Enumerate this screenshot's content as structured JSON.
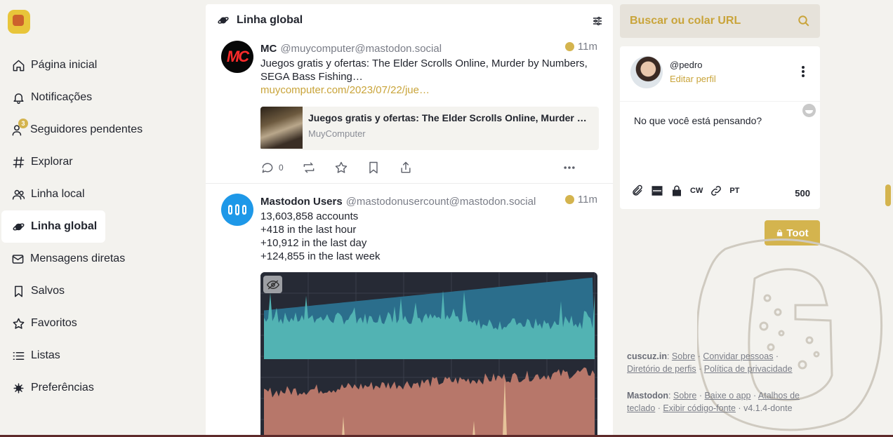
{
  "nav": {
    "items": [
      {
        "label": "Página inicial"
      },
      {
        "label": "Notificações"
      },
      {
        "label": "Seguidores pendentes",
        "badge": "3"
      },
      {
        "label": "Explorar"
      },
      {
        "label": "Linha local"
      },
      {
        "label": "Linha global"
      },
      {
        "label": "Mensagens diretas"
      },
      {
        "label": "Salvos"
      },
      {
        "label": "Favoritos"
      },
      {
        "label": "Listas"
      },
      {
        "label": "Preferências"
      }
    ]
  },
  "column": {
    "title": "Linha global"
  },
  "statuses": [
    {
      "name": "MC",
      "acct": "@muycomputer@mastodon.social",
      "time": "11m",
      "text": "Juegos gratis y ofertas: The Elder Scrolls Online, Murder by Numbers, SEGA Bass Fishing…",
      "link": "muycomputer.com/2023/07/22/jue…",
      "avatar_text": "MC",
      "card": {
        "title": "Juegos gratis y ofertas: The Elder Scrolls Online, Murder by Nu…",
        "source": "MuyComputer"
      },
      "replies": "0"
    },
    {
      "name": "Mastodon Users",
      "acct": "@mastodonusercount@mastodon.social",
      "time": "11m",
      "lines": [
        "13,603,858 accounts",
        "+418 in the last hour",
        "+10,912 in the last day",
        "+124,855 in the last week"
      ]
    }
  ],
  "search": {
    "placeholder": "Buscar ou colar URL"
  },
  "compose": {
    "handle": "@pedro",
    "edit_profile": "Editar perfil",
    "placeholder": "No que você está pensando?",
    "cw": "CW",
    "lang": "PT",
    "counter": "500",
    "submit": "Toot"
  },
  "footer": {
    "instance": "cuscuz.in",
    "about": "Sobre",
    "invite": "Convidar pessoas",
    "directory": "Diretório de perfis",
    "privacy": "Política de privacidade",
    "mastodon": "Mastodon",
    "about2": "Sobre",
    "app": "Baixe o app",
    "shortcuts": "Atalhos de teclado",
    "source": "Exibir código-fonte",
    "version": "v4.1.4-donte"
  },
  "colors": {
    "accent": "#d4b44e",
    "chart_users": "#52b3b3",
    "chart_top": "#2b6e8c",
    "chart_activity": "#b7776a"
  }
}
